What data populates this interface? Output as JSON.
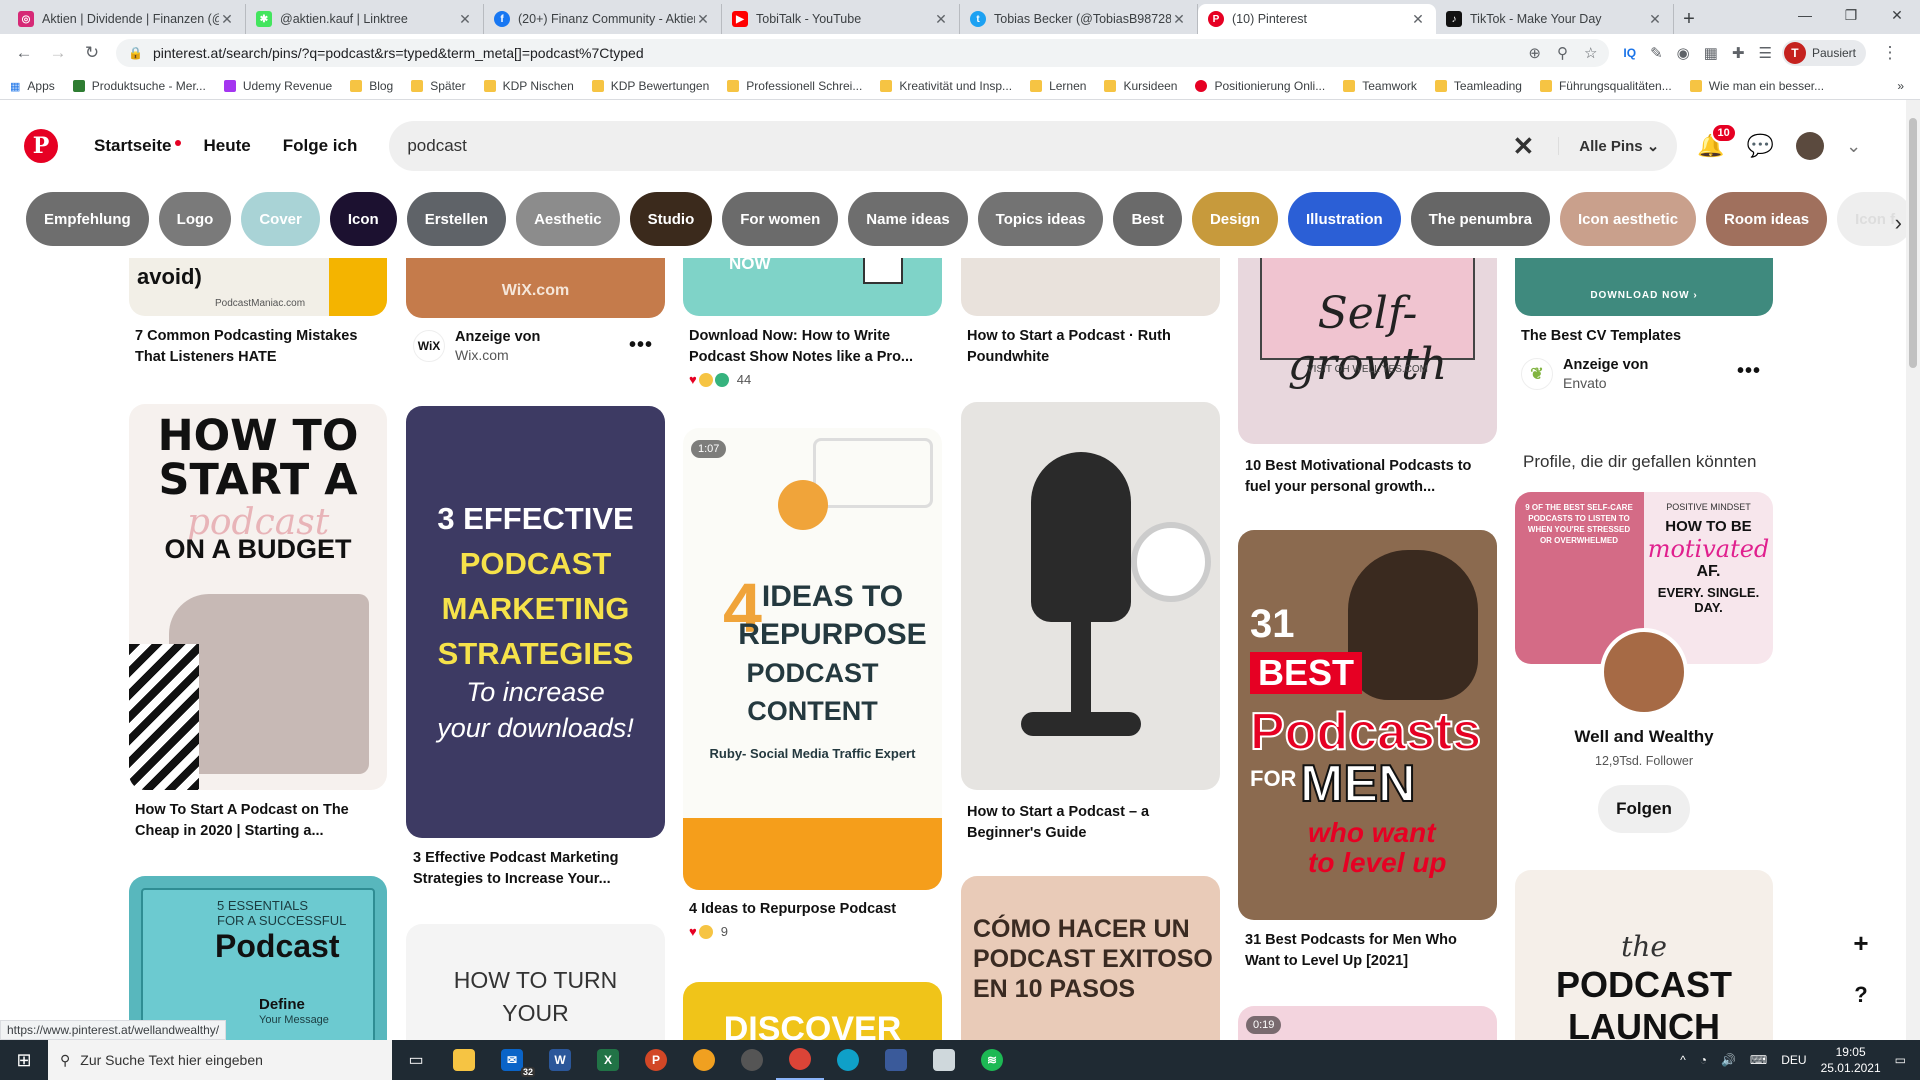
{
  "browser": {
    "tabs": [
      {
        "title": "Aktien | Dividende | Finanzen (@",
        "icon": "instagram-icon",
        "color": "#d62976"
      },
      {
        "title": "@aktien.kauf | Linktree",
        "icon": "linktree-icon",
        "color": "#43e55e"
      },
      {
        "title": "(20+) Finanz Community - Aktien",
        "icon": "facebook-icon",
        "color": "#1877f2"
      },
      {
        "title": "TobiTalk - YouTube",
        "icon": "youtube-icon",
        "color": "#ff0000"
      },
      {
        "title": "Tobias Becker (@TobiasB987283",
        "icon": "twitter-icon",
        "color": "#1da1f2"
      },
      {
        "title": "(10) Pinterest",
        "icon": "pinterest-icon",
        "color": "#e60023"
      },
      {
        "title": "TikTok - Make Your Day",
        "icon": "tiktok-icon",
        "color": "#111111"
      }
    ],
    "url": "pinterest.at/search/pins/?q=podcast&rs=typed&term_meta[]=podcast%7Ctyped",
    "profile_label": "Pausiert",
    "profile_initial": "T",
    "bookmarks": [
      "Apps",
      "Produktsuche - Mer...",
      "Udemy Revenue",
      "Blog",
      "Später",
      "KDP Nischen",
      "KDP Bewertungen",
      "Professionell Schrei...",
      "Kreativität und Insp...",
      "Lernen",
      "Kursideen",
      "Positionierung Onli...",
      "Teamwork",
      "Teamleading",
      "Führungsqualitäten...",
      "Wie man ein besser..."
    ],
    "status_url": "https://www.pinterest.at/wellandwealthy/"
  },
  "pinterest": {
    "nav": {
      "home": "Startseite",
      "today": "Heute",
      "following": "Folge ich"
    },
    "search": {
      "value": "podcast",
      "filter": "Alle Pins"
    },
    "notifications_count": "10",
    "pills": [
      {
        "label": "Empfehlung",
        "color": "#6e6e6e"
      },
      {
        "label": "Logo",
        "color": "#7a7a7a"
      },
      {
        "label": "Cover",
        "color": "#a9d3d6"
      },
      {
        "label": "Icon",
        "color": "#1c1130"
      },
      {
        "label": "Erstellen",
        "color": "#5f6368"
      },
      {
        "label": "Aesthetic",
        "color": "#8c8c8c"
      },
      {
        "label": "Studio",
        "color": "#3b2a1c"
      },
      {
        "label": "For women",
        "color": "#6b6b6b"
      },
      {
        "label": "Name ideas",
        "color": "#6e6e6e"
      },
      {
        "label": "Topics ideas",
        "color": "#737373"
      },
      {
        "label": "Best",
        "color": "#6a6a6a"
      },
      {
        "label": "Design",
        "color": "#c79a3c"
      },
      {
        "label": "Illustration",
        "color": "#2b5fd6"
      },
      {
        "label": "The penumbra",
        "color": "#666666"
      },
      {
        "label": "Icon aesthetic",
        "color": "#c9a08c"
      },
      {
        "label": "Room ideas",
        "color": "#a0705d"
      },
      {
        "label": "Icon f",
        "color": "#eeeeee"
      }
    ],
    "pins": {
      "p1": {
        "caption": "7 Common Podcasting Mistakes That Listeners HATE",
        "img_text": "avoid)",
        "img_sub": "PodcastManiac.com"
      },
      "p2": {
        "ad_label": "Anzeige von",
        "ad_source": "Wix.com",
        "img_text": "WiX.com"
      },
      "p3": {
        "caption": "Download Now: How to Write Podcast Show Notes like a Pro...",
        "img_text": "NOW",
        "reactions": "44"
      },
      "p4": {
        "caption": "How to Start a Podcast · Ruth Poundwhite"
      },
      "p5": {
        "caption": "10 Best Motivational Podcasts to fuel your personal growth...",
        "img_text": "Self-growth",
        "img_sub": "VISIT OH WELL YES.COM"
      },
      "p6": {
        "caption": "The Best CV Templates",
        "img_text": "DOWNLOAD NOW ›",
        "ad_label": "Anzeige von",
        "ad_source": "Envato"
      },
      "p7": {
        "caption": "How To Start A Podcast on The Cheap in 2020 | Starting a...",
        "img_l1": "HOW TO",
        "img_l2": "START A",
        "img_l3": "podcast",
        "img_l4": "ON A BUDGET"
      },
      "p8": {
        "caption": "3 Effective Podcast Marketing Strategies to Increase Your...",
        "img_l1": "3 EFFECTIVE",
        "img_l2": "PODCAST",
        "img_l3": "MARKETING",
        "img_l4": "STRATEGIES",
        "img_l5": "To increase",
        "img_l6": "your downloads!"
      },
      "p9": {
        "caption": "4 Ideas to Repurpose Podcast",
        "duration": "1:07",
        "img_l1": "4",
        "img_l2": "IDEAS TO",
        "img_l3": "REPURPOSE",
        "img_l4": "PODCAST CONTENT",
        "img_l5": "Ruby- Social Media Traffic Expert",
        "reactions": "9"
      },
      "p10": {
        "caption": "How to Start a Podcast – a Beginner's Guide"
      },
      "p11": {
        "caption": "31 Best Podcasts for Men Who Want to Level Up [2021]",
        "img_l1": "31",
        "img_l2": "BEST",
        "img_l3": "Podcasts",
        "img_l4": "FOR",
        "img_l5": "MEN",
        "img_l6": "who want",
        "img_l7": "to level up"
      },
      "p12": {
        "img_l1": "5 ESSENTIALS",
        "img_l2": "FOR A SUCCESSFUL",
        "img_l3": "Podcast",
        "img_l4": "Define",
        "img_l5": "Your Message"
      },
      "p13": {
        "img_l1": "HOW TO TURN",
        "img_l2": "YOUR"
      },
      "p14": {
        "img_l1": "CÓMO HACER UN",
        "img_l2": "PODCAST EXITOSO",
        "img_l3": "EN 10 PASOS"
      },
      "p15": {
        "img_text": "DISCOVER"
      },
      "p16": {
        "duration": "0:19"
      },
      "p17": {
        "img_l1": "the",
        "img_l2": "PODCAST",
        "img_l3": "LAUNCH"
      }
    },
    "profile_card": {
      "title": "Profile, die dir gefallen könnten",
      "img_left": "9 OF THE BEST SELF-CARE PODCASTS TO LISTEN TO WHEN YOU'RE STRESSED OR OVERWHELMED",
      "img_right_l1": "POSITIVE MINDSET",
      "img_right_l2": "HOW TO BE",
      "img_right_l3": "motivated",
      "img_right_l4": "AF.",
      "img_right_l5": "EVERY. SINGLE. DAY.",
      "name": "Well and Wealthy",
      "followers": "12,9Tsd. Follower",
      "follow_label": "Folgen"
    }
  },
  "taskbar": {
    "search_placeholder": "Zur Suche Text hier eingeben",
    "mail_badge": "32",
    "lang": "DEU",
    "time": "19:05",
    "date": "25.01.2021"
  }
}
